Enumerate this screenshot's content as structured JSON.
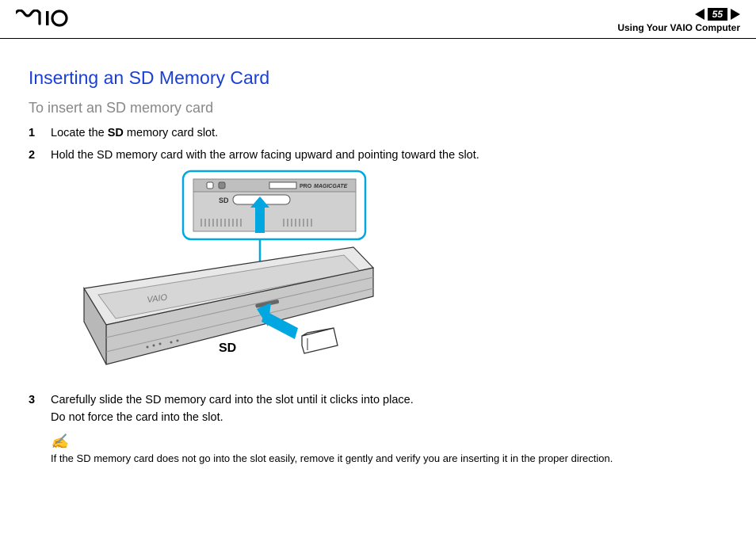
{
  "header": {
    "logo": "",
    "page_number": "55",
    "section": "Using Your VAIO Computer"
  },
  "title": "Inserting an SD Memory Card",
  "subtitle": "To insert an SD memory card",
  "steps": {
    "s1": {
      "num": "1",
      "prefix": "Locate the ",
      "bold": "SD",
      "suffix": " memory card slot."
    },
    "s2": {
      "num": "2",
      "text": "Hold the SD memory card with the arrow facing upward and pointing toward the slot."
    },
    "s3": {
      "num": "3",
      "line1": "Carefully slide the SD memory card into the slot until it clicks into place.",
      "line2": "Do not force the card into the slot."
    }
  },
  "figure": {
    "sd_label": "SD",
    "callout_labels": {
      "top_sd": "SD",
      "pro": "PRO",
      "magicgate": "MAGICGATE"
    }
  },
  "note": {
    "icon": "✍",
    "text": "If the SD memory card does not go into the slot easily, remove it gently and verify you are inserting it in the proper direction."
  }
}
